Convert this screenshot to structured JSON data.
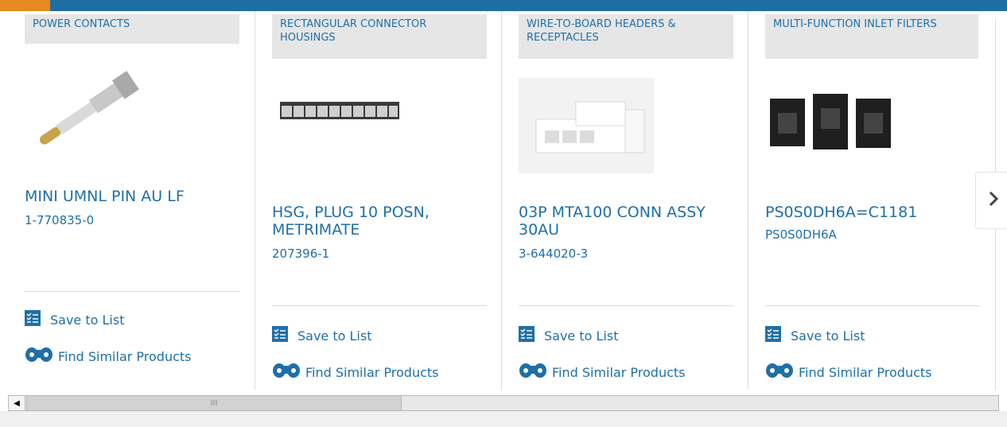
{
  "colors": {
    "brand_blue": "#1e6ea6",
    "accent_orange": "#e58a1f",
    "link_blue": "#1f6fa8",
    "category_bg": "#e6e6e6"
  },
  "cards": [
    {
      "category": "POWER CONTACTS",
      "name": "MINI UMNL PIN AU LF",
      "part": "1-770835-0",
      "save": "Save to List",
      "similar": "Find Similar Products"
    },
    {
      "category": "RECTANGULAR CONNECTOR HOUSINGS",
      "name": "HSG, PLUG 10 POSN, METRIMATE",
      "part": "207396-1",
      "save": "Save to List",
      "similar": "Find Similar Products"
    },
    {
      "category": "WIRE-TO-BOARD HEADERS & RECEPTACLES",
      "name": "03P MTA100 CONN ASSY 30AU",
      "part": "3-644020-3",
      "save": "Save to List",
      "similar": "Find Similar Products"
    },
    {
      "category": "MULTI-FUNCTION INLET FILTERS",
      "name": "PS0S0DH6A=C1181",
      "part": "PS0S0DH6A",
      "save": "Save to List",
      "similar": "Find Similar Products"
    }
  ],
  "carousel": {
    "next_icon": "chevron-right-icon"
  },
  "scrollbar": {
    "left_icon": "triangle-left-icon",
    "thumb_icon": "grip-icon"
  }
}
